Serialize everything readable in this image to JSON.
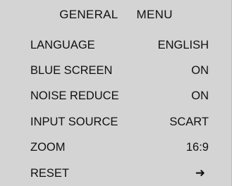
{
  "title": {
    "word1": "GENERAL",
    "word2": "MENU"
  },
  "items": [
    {
      "label": "LANGUAGE",
      "value": "ENGLISH"
    },
    {
      "label": "BLUE SCREEN",
      "value": "ON"
    },
    {
      "label": "NOISE REDUCE",
      "value": "ON"
    },
    {
      "label": "INPUT SOURCE",
      "value": "SCART"
    },
    {
      "label": "ZOOM",
      "value": "16:9"
    },
    {
      "label": "RESET",
      "value": "➜"
    }
  ],
  "colors": {
    "background": "#d4d4d4",
    "text": "#111111"
  },
  "icons": {
    "reset_action": "right-arrow-icon"
  }
}
